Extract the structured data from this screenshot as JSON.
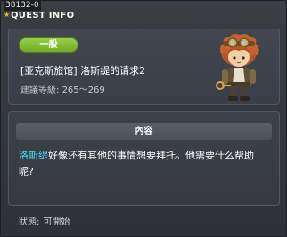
{
  "window": {
    "quest_id": "38132-0",
    "title": "QUEST INFO"
  },
  "quest": {
    "badge": "一般",
    "name": "[亚克斯旅馆] 洛斯缇的请求2",
    "level_label": "建議等級:",
    "level_range": "265～269"
  },
  "content": {
    "header": "內容",
    "npc_name": "洛斯缇",
    "text_rest": "好像还有其他的事情想要拜托。他需要什么帮助呢?"
  },
  "status": {
    "label": "狀態:",
    "value": "可開始"
  },
  "colors": {
    "badge": "#7dbb32",
    "npc_name": "#47d7f0",
    "title": "#f3f3e8"
  },
  "icons": {
    "title_decoration": "star-icon",
    "npc_portrait": "npc-portrait"
  }
}
